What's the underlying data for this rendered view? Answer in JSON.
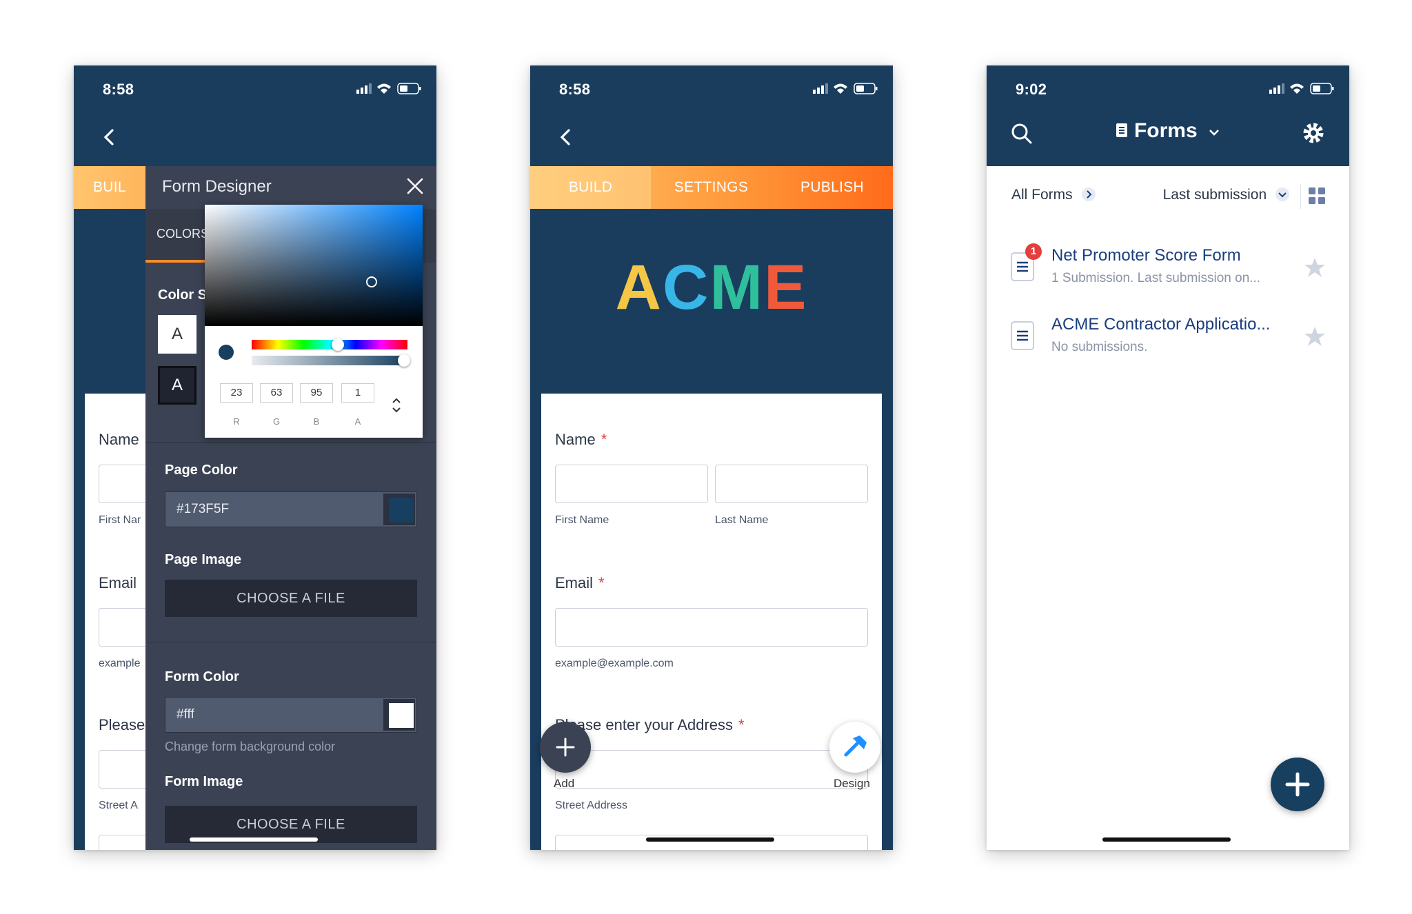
{
  "colors": {
    "navy": "#173F5F",
    "orange": "#FF8A2A",
    "accent_red": "#E53E3E"
  },
  "phone1": {
    "time": "8:58",
    "tab_build_partial": "BUIL",
    "panel": {
      "title": "Form Designer",
      "tab_colors": "COLORS",
      "color_scheme_partial": "Color S",
      "swatch_letter": "A",
      "picker": {
        "r": "23",
        "g": "63",
        "b": "95",
        "a": "1",
        "labels": [
          "R",
          "G",
          "B",
          "A"
        ]
      },
      "page_color_label": "Page Color",
      "page_color_value": "#173F5F",
      "page_image_label": "Page Image",
      "choose_file": "CHOOSE A FILE",
      "form_color_label": "Form Color",
      "form_color_value": "#fff",
      "form_color_note": "Change form background color",
      "form_image_label": "Form Image"
    },
    "bg_form": {
      "name": "Name",
      "first_partial": "First Nar",
      "email": "Email",
      "example_partial": "example",
      "please_partial": "Please",
      "street_partial": "Street A"
    }
  },
  "phone2": {
    "time": "8:58",
    "tabs": [
      "BUILD",
      "SETTINGS",
      "PUBLISH"
    ],
    "logo_letters": [
      "A",
      "C",
      "M",
      "E"
    ],
    "logo_colors": [
      "#F6C744",
      "#38B6E8",
      "#2FBF9A",
      "#F05A3A"
    ],
    "form": {
      "name_label": "Name",
      "required": "*",
      "first_name": "First Name",
      "last_name": "Last Name",
      "email_label": "Email",
      "email_hint": "example@example.com",
      "address_label": "Please enter your Address",
      "street": "Street Address"
    },
    "fab_add": "Add",
    "fab_design": "Design"
  },
  "phone3": {
    "time": "9:02",
    "title": "Forms",
    "filter_all": "All Forms",
    "sort": "Last submission",
    "forms": [
      {
        "title": "Net Promoter Score Form",
        "subtitle": "1 Submission. Last submission on...",
        "badge": "1"
      },
      {
        "title": "ACME Contractor Applicatio...",
        "subtitle": "No submissions.",
        "badge": ""
      }
    ]
  }
}
